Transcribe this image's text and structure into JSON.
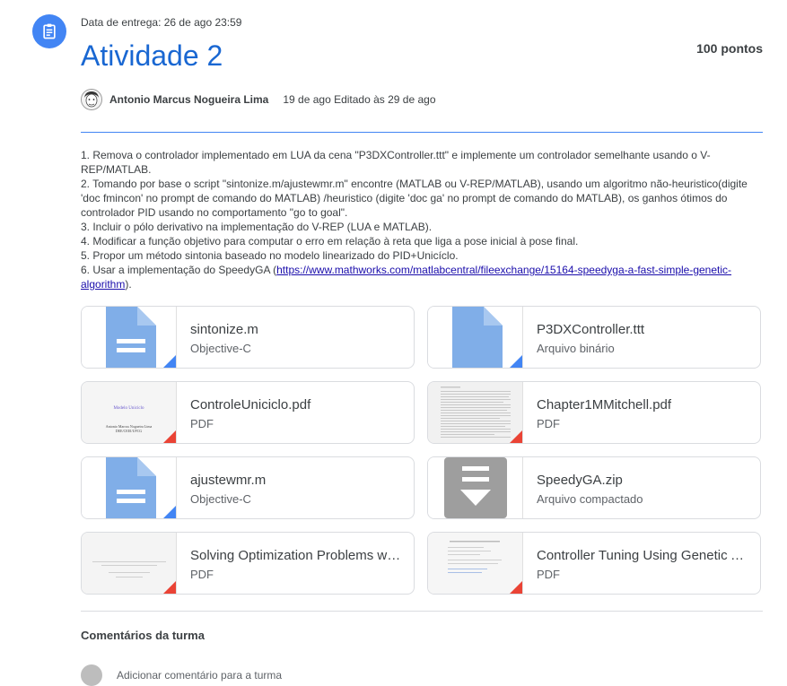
{
  "header": {
    "due_date": "Data de entrega: 26 de ago 23:59",
    "title": "Atividade 2",
    "points": "100 pontos",
    "author": "Antonio Marcus Nogueira Lima",
    "date_info": "19 de ago Editado às 29 de ago",
    "icon": "assignment-icon"
  },
  "instructions": {
    "lines": [
      "1. Remova o controlador implementado em LUA da cena \"P3DXController.ttt\" e implemente um controlador semelhante usando o V-REP/MATLAB.",
      "2. Tomando por base o script \"sintonize.m/ajustewmr.m\" encontre (MATLAB ou V-REP/MATLAB), usando um algoritmo não-heuristico(digite 'doc fmincon' no prompt de comando do MATLAB) /heuristico (digite 'doc ga' no prompt de comando do MATLAB), os ganhos ótimos do controlador PID usando no comportamento \"go to goal\".",
      "3. Incluir o pólo derivativo na implementação do V-REP (LUA e MATLAB).",
      "4. Modificar a função objetivo para computar o erro em relação à reta que liga a pose inicial à pose final.",
      "5. Propor um método sintonia baseado no modelo linearizado do PID+Unicíclo."
    ],
    "line6_prefix": "6. Usar a implementação do SpeedyGA (",
    "line6_link": "https://www.mathworks.com/matlabcentral/fileexchange/15164-speedyga-a-fast-simple-genetic-algorithm",
    "line6_suffix": ")."
  },
  "attachments": [
    {
      "name": "sintonize.m",
      "type": "Objective-C",
      "kind": "doc"
    },
    {
      "name": "P3DXController.ttt",
      "type": "Arquivo binário",
      "kind": "doc"
    },
    {
      "name": "ControleUniciclo.pdf",
      "type": "PDF",
      "kind": "slide",
      "thumb_title": "Modelo Uniciclo",
      "thumb_author": "Antonio Marcus Nogueira Lima",
      "thumb_inst": "DEE/CEEI/UFCG"
    },
    {
      "name": "Chapter1MMitchell.pdf",
      "type": "PDF",
      "kind": "text"
    },
    {
      "name": "ajustewmr.m",
      "type": "Objective-C",
      "kind": "doc"
    },
    {
      "name": "SpeedyGA.zip",
      "type": "Arquivo compactado",
      "kind": "zip"
    },
    {
      "name": "Solving Optimization Problems with MATLAB",
      "type": "PDF",
      "kind": "text-center"
    },
    {
      "name": "Controller Tuning Using Genetic Algorithm",
      "type": "PDF",
      "kind": "text-title"
    }
  ],
  "comments": {
    "label": "Comentários da turma",
    "placeholder": "Adicionar comentário para a turma"
  },
  "colors": {
    "accent": "#1967d2",
    "icon_bg": "#4285f4",
    "doc_blue": "#80aee8",
    "pdf_red": "#ea4335",
    "zip_gray": "#9e9e9e"
  }
}
